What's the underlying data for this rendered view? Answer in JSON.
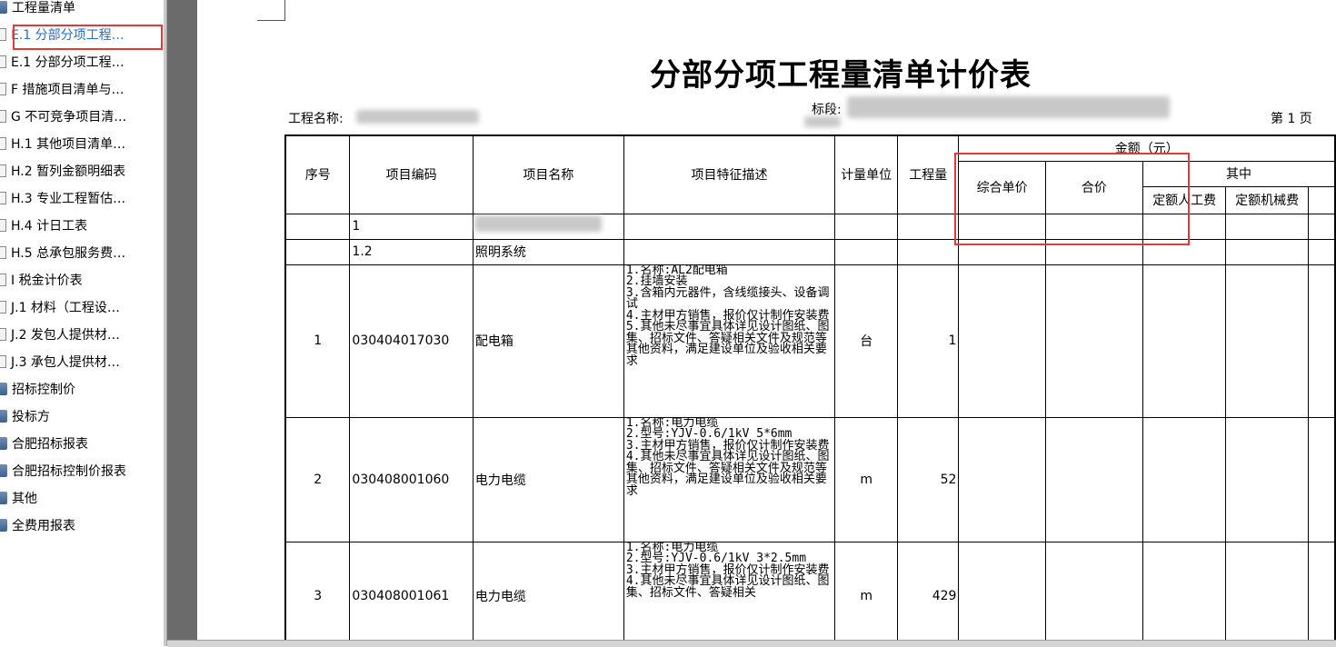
{
  "tree": {
    "items": [
      {
        "label": "工程量清单",
        "icon": "folder-icon",
        "selected": false
      },
      {
        "label": "E.1 分部分项工程…",
        "icon": "node-icon",
        "selected": true
      },
      {
        "label": "E.1 分部分项工程…",
        "icon": "node-icon",
        "selected": false
      },
      {
        "label": "F 措施项目清单与…",
        "icon": "node-icon",
        "selected": false
      },
      {
        "label": "G 不可竞争项目清…",
        "icon": "node-icon",
        "selected": false
      },
      {
        "label": "H.1 其他项目清单…",
        "icon": "node-icon",
        "selected": false
      },
      {
        "label": "H.2 暂列金额明细表",
        "icon": "node-icon",
        "selected": false
      },
      {
        "label": "H.3 专业工程暂估…",
        "icon": "node-icon",
        "selected": false
      },
      {
        "label": "H.4 计日工表",
        "icon": "node-icon",
        "selected": false
      },
      {
        "label": "H.5 总承包服务费…",
        "icon": "node-icon",
        "selected": false
      },
      {
        "label": "I 税金计价表",
        "icon": "node-icon",
        "selected": false
      },
      {
        "label": "J.1 材料（工程设…",
        "icon": "node-icon",
        "selected": false
      },
      {
        "label": "J.2 发包人提供材…",
        "icon": "node-icon",
        "selected": false
      },
      {
        "label": "J.3 承包人提供材…",
        "icon": "node-icon",
        "selected": false
      },
      {
        "label": "招标控制价",
        "icon": "folder-icon",
        "selected": false
      },
      {
        "label": "投标方",
        "icon": "folder-icon",
        "selected": false
      },
      {
        "label": "合肥招标报表",
        "icon": "folder-icon",
        "selected": false
      },
      {
        "label": "合肥招标控制价报表",
        "icon": "folder-icon",
        "selected": false
      },
      {
        "label": "其他",
        "icon": "folder-icon",
        "selected": false
      },
      {
        "label": "全费用报表",
        "icon": "folder-icon",
        "selected": false
      }
    ]
  },
  "report": {
    "title": "分部分项工程量清单计价表",
    "project_name_label": "工程名称:",
    "section_label": "标段:",
    "page_label": "第 1 页",
    "headers": {
      "seq": "序号",
      "code": "项目编码",
      "name": "项目名称",
      "desc": "项目特征描述",
      "unit": "计量单位",
      "qty": "工程量",
      "amount": "金额（元）",
      "unit_price": "综合单价",
      "total": "合价",
      "of_which": "其中",
      "labor": "定额人工费",
      "machine": "定额机械费"
    },
    "group_rows": [
      {
        "code": "1",
        "name": ""
      },
      {
        "code": "1.2",
        "name": "照明系统"
      }
    ],
    "rows": [
      {
        "seq": "1",
        "code": "030404017030",
        "name": "配电箱",
        "desc": "1.名称:AL2配电箱\n2.挂墙安装\n3.含箱内元器件，含线缆接头、设备调试\n4.主材甲方销售，报价仅计制作安装费\n5.其他未尽事宜具体详见设计图纸、图集、招标文件、答疑相关文件及规范等其他资料，满足建设单位及验收相关要求",
        "unit": "台",
        "qty": "1"
      },
      {
        "seq": "2",
        "code": "030408001060",
        "name": "电力电缆",
        "desc": "1.名称:电力电缆\n2.型号:YJV-0.6/1kV 5*6mm\n3.主材甲方销售，报价仅计制作安装费\n4.其他未尽事宜具体详见设计图纸、图集、招标文件、答疑相关文件及规范等其他资料，满足建设单位及验收相关要求",
        "unit": "m",
        "qty": "52"
      },
      {
        "seq": "3",
        "code": "030408001061",
        "name": "电力电缆",
        "desc": "1.名称:电力电缆\n2.型号:YJV-0.6/1kV 3*2.5mm\n3.主材甲方销售，报价仅计制作安装费\n4.其他未尽事宜具体详见设计图纸、图集、招标文件、答疑相关",
        "unit": "m",
        "qty": "429"
      }
    ]
  }
}
